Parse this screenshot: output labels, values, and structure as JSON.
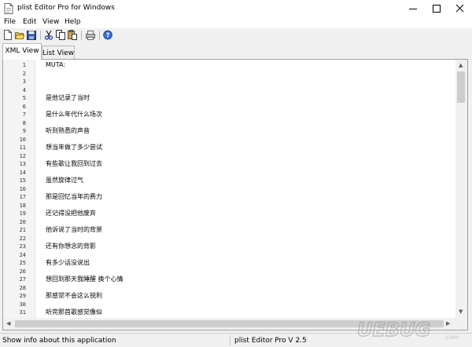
{
  "window": {
    "title": "plist Editor Pro for Windows",
    "icon": "document-icon"
  },
  "menu": [
    "File",
    "Edit",
    "View",
    "Help"
  ],
  "toolbar": {
    "buttons": [
      "new-icon",
      "open-icon",
      "save-icon",
      "cut-icon",
      "copy-icon",
      "paste-icon",
      "print-icon",
      "help-icon"
    ]
  },
  "tabs": [
    {
      "label": "XML View",
      "active": true
    },
    {
      "label": "List View",
      "active": false
    }
  ],
  "editor": {
    "lines": [
      {
        "n": "1",
        "text": "MUTA:"
      },
      {
        "n": "2",
        "text": ""
      },
      {
        "n": "3",
        "text": ""
      },
      {
        "n": "4",
        "text": ""
      },
      {
        "n": "5",
        "text": "是他记录了当时"
      },
      {
        "n": "6",
        "text": ""
      },
      {
        "n": "7",
        "text": "是什么年代什么场次"
      },
      {
        "n": "8",
        "text": ""
      },
      {
        "n": "9",
        "text": "听到熟悉的声音"
      },
      {
        "n": "10",
        "text": ""
      },
      {
        "n": "11",
        "text": "想当年做了多少尝试"
      },
      {
        "n": "12",
        "text": ""
      },
      {
        "n": "13",
        "text": "有些歌让我回到过去"
      },
      {
        "n": "14",
        "text": ""
      },
      {
        "n": "15",
        "text": "虽然旋律过气"
      },
      {
        "n": "16",
        "text": ""
      },
      {
        "n": "17",
        "text": "那是回忆当年的费力"
      },
      {
        "n": "18",
        "text": ""
      },
      {
        "n": "19",
        "text": "还记得没把他废弃"
      },
      {
        "n": "20",
        "text": ""
      },
      {
        "n": "21",
        "text": "他诉说了当时的背景"
      },
      {
        "n": "22",
        "text": ""
      },
      {
        "n": "23",
        "text": "还有你想念的背影"
      },
      {
        "n": "24",
        "text": ""
      },
      {
        "n": "25",
        "text": "有多少话没说出"
      },
      {
        "n": "26",
        "text": ""
      },
      {
        "n": "27",
        "text": "想回到那天我睡醒 换个心情"
      },
      {
        "n": "28",
        "text": ""
      },
      {
        "n": "29",
        "text": "那感觉不会这么锐利"
      },
      {
        "n": "30",
        "text": ""
      },
      {
        "n": "31",
        "text": "听完那首歌感觉像似"
      }
    ]
  },
  "status": {
    "left": "Show info about this application",
    "right": "plist Editor Pro V 2.5"
  },
  "watermark": {
    "text": "UEBUG",
    "suffix": ".com"
  },
  "colors": {
    "titlebar": "#ffffff",
    "chrome": "#f0f0f0",
    "accent": "#1565c0"
  }
}
